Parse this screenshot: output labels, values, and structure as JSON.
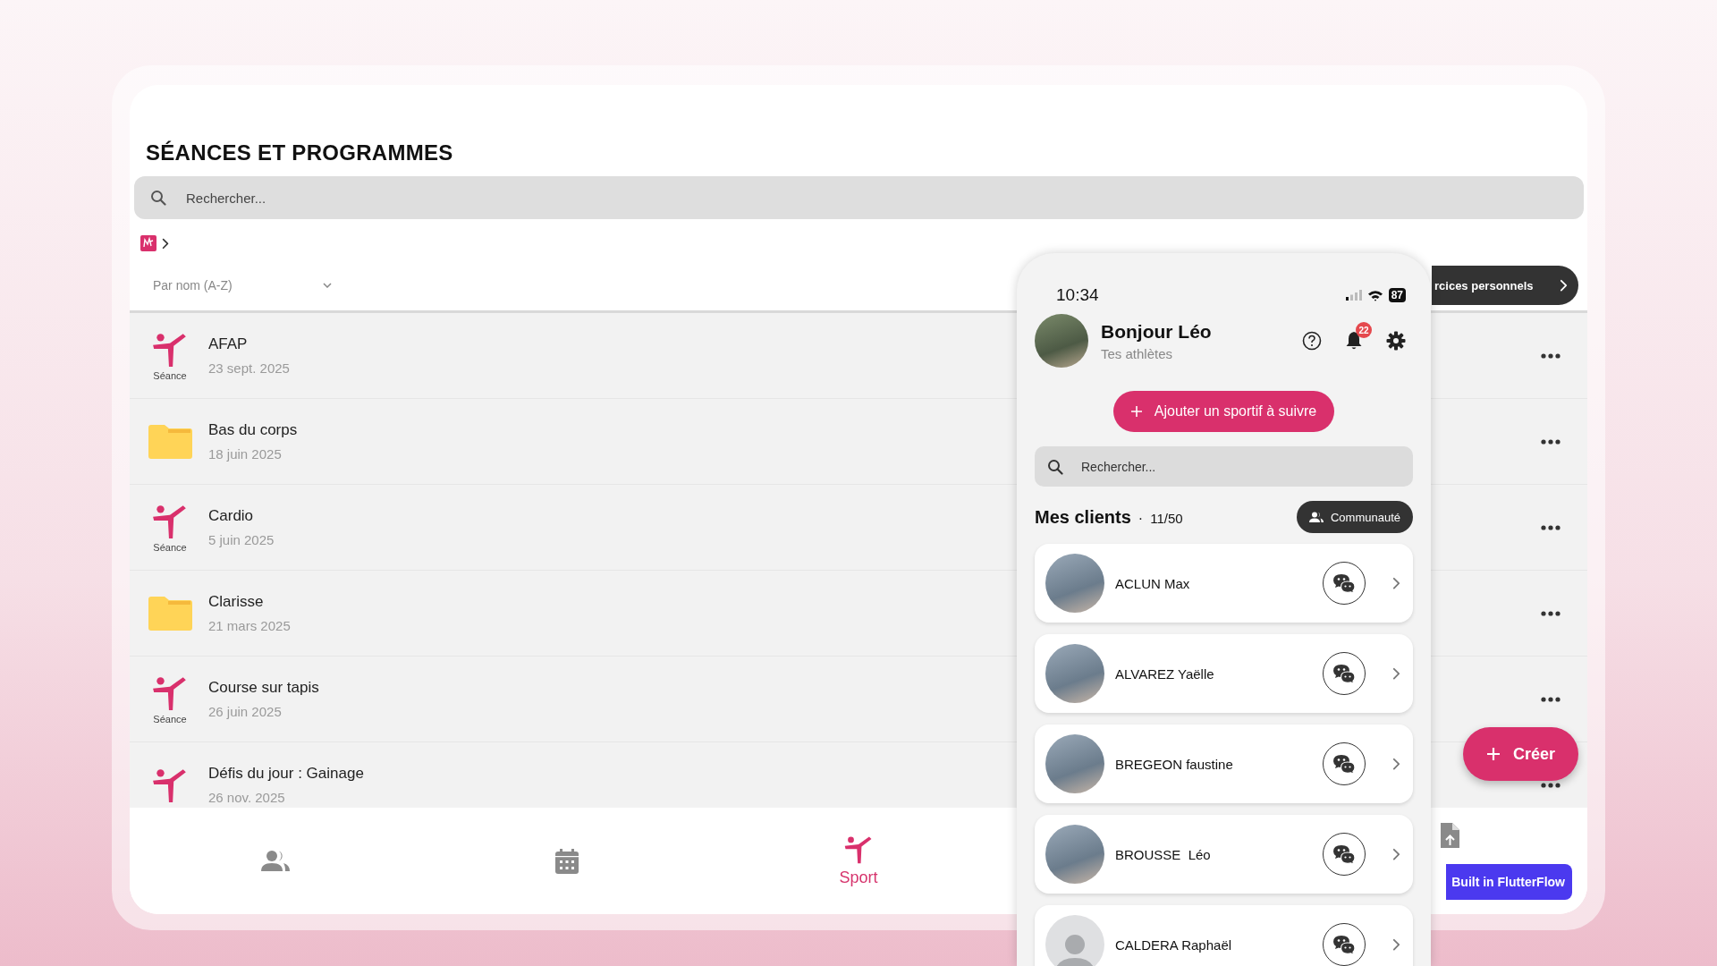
{
  "screen": {
    "title": "SÉANCES ET PROGRAMMES",
    "search": {
      "placeholder": "Rechercher..."
    },
    "sort": {
      "value": "Par nom (A-Z)"
    },
    "personal_button": {
      "label": "rcices personnels"
    },
    "items": [
      {
        "kind": "session",
        "name": "AFAP",
        "date": "23 sept. 2025",
        "type_label": "Séance"
      },
      {
        "kind": "folder",
        "name": "Bas du corps",
        "date": "18 juin 2025"
      },
      {
        "kind": "session",
        "name": "Cardio",
        "date": "5 juin 2025",
        "type_label": "Séance"
      },
      {
        "kind": "folder",
        "name": "Clarisse",
        "date": "21 mars 2025"
      },
      {
        "kind": "session",
        "name": "Course sur tapis",
        "date": "26 juin 2025",
        "type_label": "Séance"
      },
      {
        "kind": "session",
        "name": "Défis du jour : Gainage",
        "date": "26 nov. 2025"
      }
    ],
    "create_button": {
      "label": "Créer"
    },
    "bottom_nav": [
      {
        "kind": "clients",
        "selected": false
      },
      {
        "kind": "calendar",
        "selected": false
      },
      {
        "kind": "sport",
        "label": "Sport",
        "selected": true
      },
      {
        "kind": "document",
        "selected": false
      }
    ],
    "badge": {
      "label": "Built in FlutterFlow"
    }
  },
  "phone": {
    "status_bar": {
      "time": "10:34",
      "battery": "87"
    },
    "greeting": "Bonjour Léo",
    "subtitle": "Tes athlètes",
    "notifications_count": "22",
    "add_button": {
      "label": "Ajouter un sportif à suivre"
    },
    "search": {
      "placeholder": "Rechercher..."
    },
    "clients_title": "Mes clients",
    "separator": "·",
    "clients_count": "11/50",
    "community_button": {
      "label": "Communauté"
    },
    "clients": [
      {
        "name": "ACLUN Max",
        "kind": "photo"
      },
      {
        "name": "ALVAREZ Yaëlle",
        "kind": "photo"
      },
      {
        "name": "BREGEON faustine",
        "kind": "photo"
      },
      {
        "name": "BROUSSE  Léo",
        "kind": "photo"
      },
      {
        "name": "CALDERA Raphaël",
        "kind": "default"
      }
    ]
  }
}
